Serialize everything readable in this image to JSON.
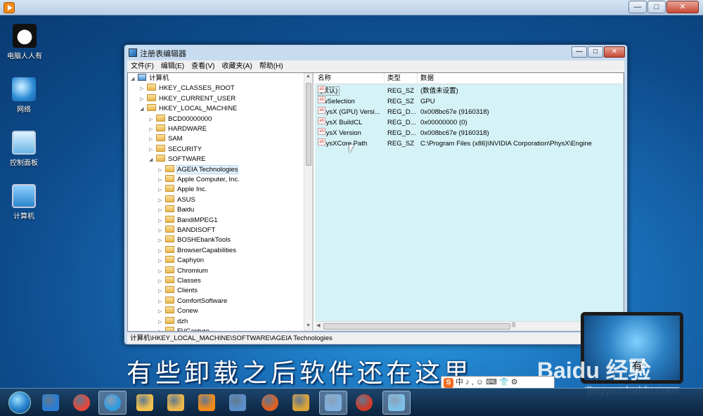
{
  "outer_window": {
    "controls": [
      "—",
      "□",
      "✕"
    ]
  },
  "desktop_icons": [
    {
      "label": "电脑人人有",
      "icon": "panda-icon"
    },
    {
      "label": "网络",
      "icon": "network-icon"
    },
    {
      "label": "控制面板",
      "icon": "control-panel-icon"
    },
    {
      "label": "计算机",
      "icon": "computer-icon"
    }
  ],
  "regedit": {
    "title": "注册表编辑器",
    "controls": [
      "—",
      "□",
      "✕"
    ],
    "menu": [
      "文件(F)",
      "编辑(E)",
      "查看(V)",
      "收藏夹(A)",
      "帮助(H)"
    ],
    "tree": [
      {
        "label": "计算机",
        "level": 0,
        "expanded": true,
        "type": "computer"
      },
      {
        "label": "HKEY_CLASSES_ROOT",
        "level": 1
      },
      {
        "label": "HKEY_CURRENT_USER",
        "level": 1
      },
      {
        "label": "HKEY_LOCAL_MACHINE",
        "level": 1,
        "expanded": true
      },
      {
        "label": "BCD00000000",
        "level": 2
      },
      {
        "label": "HARDWARE",
        "level": 2
      },
      {
        "label": "SAM",
        "level": 2
      },
      {
        "label": "SECURITY",
        "level": 2
      },
      {
        "label": "SOFTWARE",
        "level": 2,
        "expanded": true
      },
      {
        "label": "AGEIA Technologies",
        "level": 3,
        "selected": true
      },
      {
        "label": "Apple Computer, Inc.",
        "level": 3
      },
      {
        "label": "Apple Inc.",
        "level": 3
      },
      {
        "label": "ASUS",
        "level": 3
      },
      {
        "label": "Baidu",
        "level": 3
      },
      {
        "label": "BandiMPEG1",
        "level": 3
      },
      {
        "label": "BANDISOFT",
        "level": 3
      },
      {
        "label": "BOSHEbankTools",
        "level": 3
      },
      {
        "label": "BrowserCapabilities",
        "level": 3
      },
      {
        "label": "Caphyon",
        "level": 3
      },
      {
        "label": "Chromium",
        "level": 3
      },
      {
        "label": "Classes",
        "level": 3
      },
      {
        "label": "Clients",
        "level": 3
      },
      {
        "label": "ComfortSoftware",
        "level": 3
      },
      {
        "label": "Conew",
        "level": 3
      },
      {
        "label": "dzh",
        "level": 3
      },
      {
        "label": "FVCapture",
        "level": 3
      }
    ],
    "list_headers": [
      "名称",
      "类型",
      "数据"
    ],
    "values": [
      {
        "name": "(默认)",
        "type": "REG_SZ",
        "data": "(数值未设置)",
        "is_default": true
      },
      {
        "name": "HwSelection",
        "type": "REG_SZ",
        "data": "GPU"
      },
      {
        "name": "PhysX (GPU) Versi...",
        "type": "REG_D...",
        "data": "0x008bc67e (9160318)"
      },
      {
        "name": "PhysX BuildCL",
        "type": "REG_D...",
        "data": "0x00000000 (0)"
      },
      {
        "name": "PhysX Version",
        "type": "REG_D...",
        "data": "0x008bc67e (9160318)"
      },
      {
        "name": "PhysXCore Path",
        "type": "REG_SZ",
        "data": "C:\\Program Files (x86)\\NVIDIA Corporation\\PhysX\\Engine"
      }
    ],
    "status_path": "计算机\\HKEY_LOCAL_MACHINE\\SOFTWARE\\AGEIA Technologies"
  },
  "subtitle": "有些卸载之后软件还在这里",
  "watermark": {
    "brand": "Baidu",
    "product": "经验",
    "url": "jingyan.baidu.com",
    "badge": "有"
  },
  "ime": {
    "logo": "S",
    "mode": "中",
    "extra": "♪ ,  ☺ ⌨ 👕 ⚙"
  },
  "taskbar_items": [
    "internet-explorer-icon",
    "chrome-icon",
    "browser-icon",
    "folder-icon",
    "file-explorer-icon",
    "media-player-icon",
    "remote-desktop-icon",
    "p-app-icon",
    "paint-icon",
    "settings-icon",
    "game-icon",
    "regedit-icon"
  ],
  "colors": {
    "list_background": "#d5f2f6",
    "selection": "#e5f1fb"
  }
}
